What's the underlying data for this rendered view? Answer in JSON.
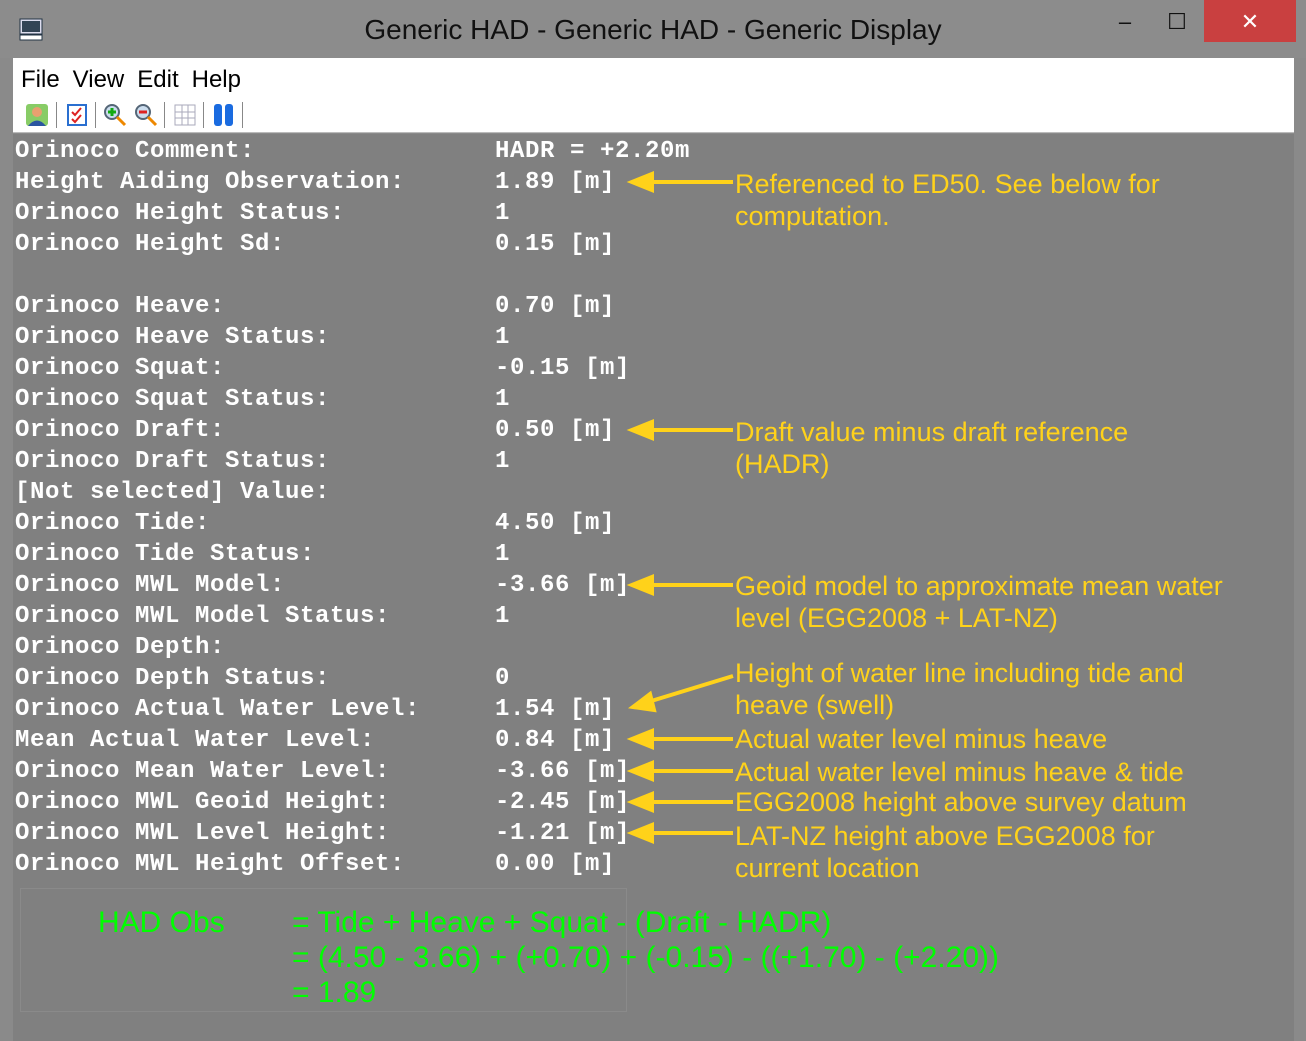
{
  "window": {
    "title": "Generic HAD - Generic HAD  - Generic Display",
    "minimize": "–",
    "maximize": "☐",
    "close": "✕"
  },
  "menu": [
    "File",
    "View",
    "Edit",
    "Help"
  ],
  "toolbar": [
    "user-icon",
    "checklist-icon",
    "zoom-in-icon",
    "zoom-out-icon",
    "grid-icon",
    "columns-icon"
  ],
  "rows": [
    {
      "label": "Orinoco Comment:",
      "value": "HADR = +2.20m"
    },
    {
      "label": "Height Aiding Observation:",
      "value": "1.89 [m]"
    },
    {
      "label": "Orinoco Height Status:",
      "value": "1"
    },
    {
      "label": "Orinoco Height Sd:",
      "value": "0.15 [m]"
    },
    {
      "label": "",
      "value": ""
    },
    {
      "label": "Orinoco Heave:",
      "value": "0.70 [m]"
    },
    {
      "label": "Orinoco Heave Status:",
      "value": "1"
    },
    {
      "label": "Orinoco Squat:",
      "value": "-0.15 [m]"
    },
    {
      "label": "Orinoco Squat Status:",
      "value": "1"
    },
    {
      "label": "Orinoco Draft:",
      "value": "0.50 [m]"
    },
    {
      "label": "Orinoco Draft Status:",
      "value": "1"
    },
    {
      "label": "[Not selected] Value:",
      "value": ""
    },
    {
      "label": "Orinoco Tide:",
      "value": "4.50 [m]"
    },
    {
      "label": "Orinoco Tide Status:",
      "value": "1"
    },
    {
      "label": "Orinoco MWL Model:",
      "value": "-3.66 [m]"
    },
    {
      "label": "Orinoco MWL Model Status:",
      "value": "1"
    },
    {
      "label": "Orinoco Depth:",
      "value": ""
    },
    {
      "label": "Orinoco Depth Status:",
      "value": "0"
    },
    {
      "label": "Orinoco Actual Water Level:",
      "value": "1.54 [m]"
    },
    {
      "label": "Mean Actual Water Level:",
      "value": "0.84 [m]"
    },
    {
      "label": "Orinoco Mean Water Level:",
      "value": "-3.66 [m]"
    },
    {
      "label": "Orinoco MWL Geoid Height:",
      "value": "-2.45 [m]"
    },
    {
      "label": "Orinoco MWL Level Height:",
      "value": "-1.21 [m]"
    },
    {
      "label": "Orinoco MWL Height Offset:",
      "value": "0.00 [m]"
    }
  ],
  "annotations": [
    "Referenced to ED50. See below for computation.",
    "Draft value minus draft reference (HADR)",
    "Geoid model to approximate mean water level (EGG2008 + LAT-NZ)",
    "Height of water line including tide and heave (swell)",
    "Actual water level minus heave",
    "Actual water level minus heave & tide",
    "EGG2008 height above survey datum",
    "LAT-NZ height above EGG2008 for current location"
  ],
  "formula": {
    "label": "HAD Obs",
    "line1": "= Tide + Heave + Squat - (Draft - HADR)",
    "line2": "= (4.50 - 3.66) + (+0.70) + (-0.15) - ((+1.70) - (+2.20))",
    "line3": "= 1.89"
  },
  "colors": {
    "annotation": "#ffd21a",
    "formula": "#00ff00",
    "background": "#808080"
  }
}
